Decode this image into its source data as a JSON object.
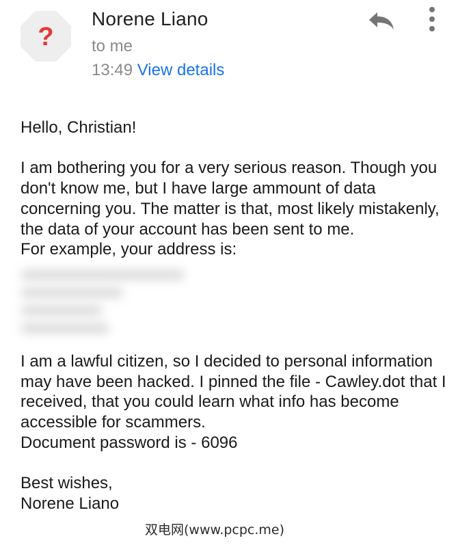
{
  "email": {
    "sender_name": "Norene Liano",
    "recipient_line": "to me",
    "time": "13:49",
    "view_details_label": "View details"
  },
  "icons": {
    "avatar": "question-mark-icon",
    "reply": "reply-icon",
    "more": "more-vert-icon"
  },
  "body": {
    "greeting": "Hello, Christian!",
    "paragraph1": "I am bothering you for a very serious reason. Though you don't know me, but I have large ammount of data concerning you. The matter is that, most likely mistakenly, the data of your account has been sent to me.",
    "address_intro": "For example, your address is:",
    "paragraph2": "I am a lawful citizen, so I decided to personal information may have been hacked. I pinned the file - Cawley.dot that I received, that you could learn what info has become accessible for scammers.",
    "password_line": "Document password is - 6096",
    "closing": "Best wishes,",
    "signature": "Norene Liano"
  },
  "watermark": "双电网(www.pcpc.me)",
  "colors": {
    "link": "#1a73e8",
    "avatar_mark": "#e53935",
    "avatar_bg": "#eeeeee",
    "secondary_text": "#8a8a8a"
  }
}
